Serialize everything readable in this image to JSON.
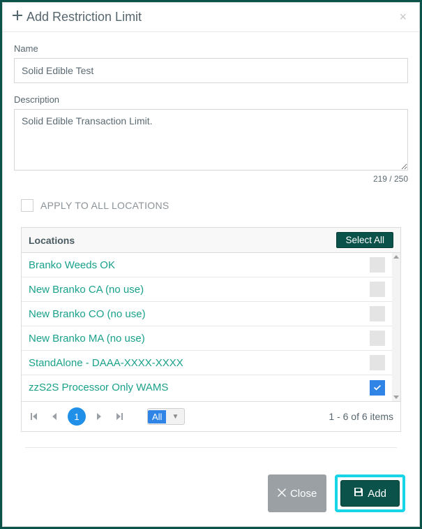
{
  "header": {
    "title": "Add Restriction Limit"
  },
  "form": {
    "name_label": "Name",
    "name_value": "Solid Edible Test",
    "desc_label": "Description",
    "desc_value": "Solid Edible Transaction Limit.",
    "char_count": "219 / 250",
    "apply_all_label": "APPLY TO ALL LOCATIONS"
  },
  "grid": {
    "header": "Locations",
    "select_all": "Select All",
    "rows": [
      {
        "name": "Branko Weeds OK",
        "checked": false
      },
      {
        "name": "New Branko CA (no use)",
        "checked": false
      },
      {
        "name": "New Branko CO (no use)",
        "checked": false
      },
      {
        "name": "New Branko MA (no use)",
        "checked": false
      },
      {
        "name": "StandAlone - DAAA-XXXX-XXXX",
        "checked": false
      },
      {
        "name": "zzS2S Processor Only WAMS",
        "checked": true
      }
    ],
    "pager": {
      "page": "1",
      "page_size": "All",
      "info": "1 - 6 of 6 items"
    }
  },
  "footer": {
    "close": "Close",
    "add": "Add"
  }
}
